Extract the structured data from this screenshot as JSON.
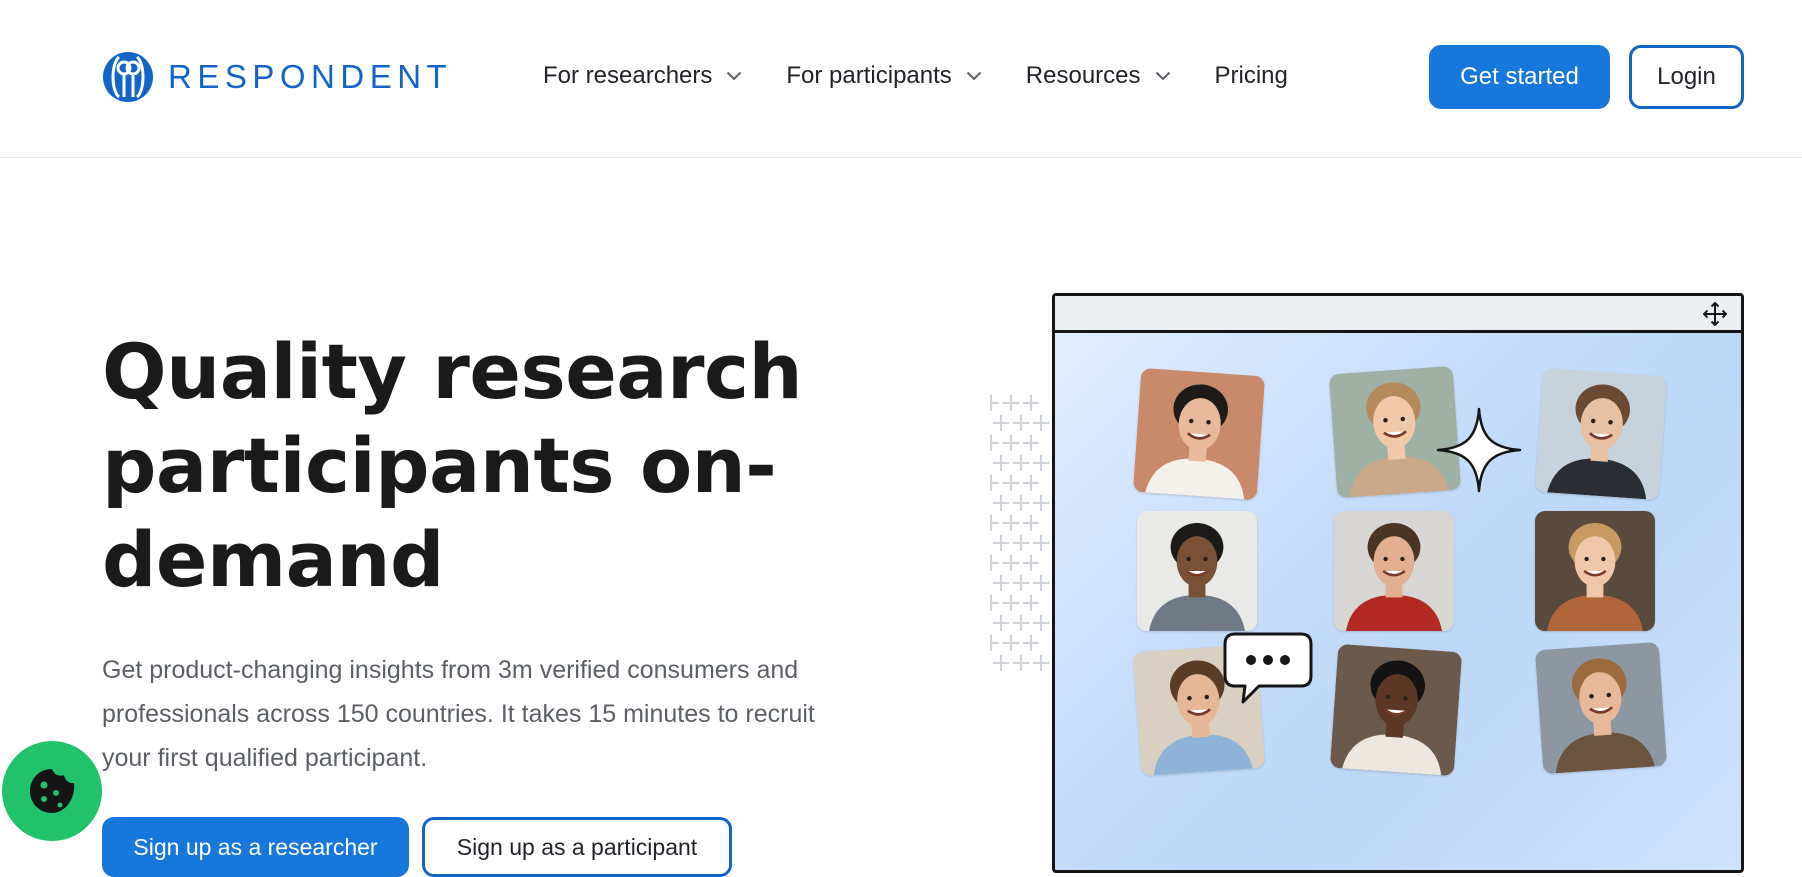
{
  "brand": {
    "name": "RESPONDENT",
    "accent": "#1877db"
  },
  "nav": {
    "items": [
      {
        "label": "For researchers",
        "has_dropdown": true
      },
      {
        "label": "For participants",
        "has_dropdown": true
      },
      {
        "label": "Resources",
        "has_dropdown": true
      },
      {
        "label": "Pricing",
        "has_dropdown": false
      }
    ],
    "get_started": "Get started",
    "login": "Login"
  },
  "hero": {
    "title_lines": [
      "Quality research",
      "participants on-",
      "demand"
    ],
    "subtitle": "Get product-changing insights from 3m verified consumers and professionals across 150 countries. It takes 15 minutes to recruit your first qualified participant.",
    "cta_researcher": "Sign up as a researcher",
    "cta_participant": "Sign up as a participant"
  },
  "illustration": {
    "window_icon": "move-icon",
    "decorations": [
      "sparkle-icon",
      "typing-bubble-icon",
      "plus-pattern"
    ],
    "participants": [
      {
        "name": "participant-avatar",
        "bg": "#c98a6b",
        "skin": "#e8b99a",
        "hair": "#1e1a18",
        "shirt": "#f4f1ec"
      },
      {
        "name": "participant-avatar",
        "bg": "#9fb0a5",
        "skin": "#f1c9a8",
        "hair": "#b48a5c",
        "shirt": "#c9a98a"
      },
      {
        "name": "participant-avatar",
        "bg": "#c6d3dc",
        "skin": "#e8c0a2",
        "hair": "#6b4a33",
        "shirt": "#2a2e33"
      },
      {
        "name": "participant-avatar",
        "bg": "#e9e9e7",
        "skin": "#7a5136",
        "hair": "#1c1a19",
        "shirt": "#6f7a86"
      },
      {
        "name": "participant-avatar",
        "bg": "#d8d6d2",
        "skin": "#e2b090",
        "hair": "#4a3424",
        "shirt": "#b32a25"
      },
      {
        "name": "participant-avatar",
        "bg": "#5a4a3e",
        "skin": "#f0c7a8",
        "hair": "#c79a62",
        "shirt": "#b0653a"
      },
      {
        "name": "participant-avatar",
        "bg": "#d9cfc3",
        "skin": "#e6b797",
        "hair": "#5a3d27",
        "shirt": "#8fb3d8"
      },
      {
        "name": "participant-avatar",
        "bg": "#6b5a4c",
        "skin": "#5a3825",
        "hair": "#141212",
        "shirt": "#ece7df"
      },
      {
        "name": "participant-avatar",
        "bg": "#8c97a1",
        "skin": "#e8b89a",
        "hair": "#9a6b3e",
        "shirt": "#6b5540"
      }
    ]
  },
  "cookie": {
    "icon": "cookie-icon",
    "color": "#22c16b"
  }
}
